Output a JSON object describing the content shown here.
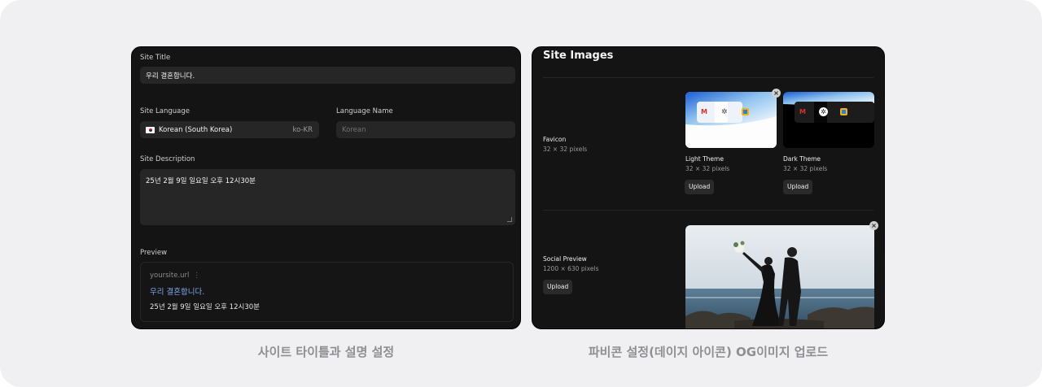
{
  "left_panel": {
    "site_title_label": "Site Title",
    "site_title_value": "우리 결혼합니다.",
    "site_language_label": "Site Language",
    "language_value": "Korean (South Korea)",
    "language_code": "ko-KR",
    "language_name_label": "Language Name",
    "language_name_placeholder": "Korean",
    "site_description_label": "Site Description",
    "site_description_value": "25년 2월 9일 일요일 오후 12시30분",
    "preview_label": "Preview",
    "preview_url": "yoursite.url",
    "preview_menu": "⋮",
    "preview_title": "우리 결혼합니다.",
    "preview_description": "25년 2월 9일 일요일 오후 12시30분"
  },
  "right_panel": {
    "title": "Site Images",
    "favicon": {
      "name": "Favicon",
      "size": "32 × 32 pixels",
      "light": {
        "name": "Light Theme",
        "size": "32 × 32 pixels",
        "upload_label": "Upload"
      },
      "dark": {
        "name": "Dark Theme",
        "size": "32 × 32 pixels",
        "upload_label": "Upload"
      }
    },
    "social": {
      "name": "Social Preview",
      "size": "1200 × 630 pixels",
      "upload_label": "Upload"
    },
    "close_glyph": "×"
  },
  "captions": {
    "left": "사이트 타이틀과 설명 설정",
    "right": "파비콘 설정(데이지 아이콘) OG이미지 업로드"
  },
  "colors": {
    "stage_bg": "#f0f0f2",
    "panel_bg": "#141414",
    "field_bg": "#262626",
    "link_blue": "#7ea7e8"
  }
}
